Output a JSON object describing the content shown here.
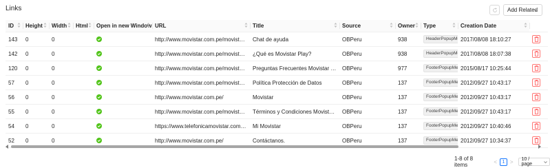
{
  "page": {
    "title": "Links"
  },
  "toolbar": {
    "add_related_label": "Add Related"
  },
  "table": {
    "columns": [
      "ID",
      "Height",
      "Width",
      "Html",
      "Open in new Window",
      "URL",
      "Title",
      "Source",
      "Owner",
      "Type",
      "Creation Date"
    ],
    "rows": [
      {
        "id": "143",
        "height": "0",
        "width": "0",
        "html": "",
        "new_window": true,
        "url": "http://www.movistar.com.pe/movistar-...",
        "title": "Chat de ayuda",
        "source": "OBPeru",
        "owner": "938",
        "type": "HeaderPopupMessage",
        "created": "2017/08/08 18:10:27"
      },
      {
        "id": "142",
        "height": "0",
        "width": "0",
        "html": "",
        "new_window": true,
        "url": "http://www.movistar.com.pe/movistar-...",
        "title": "¿Qué es Movistar Play?",
        "source": "OBPeru",
        "owner": "938",
        "type": "HeaderPopupMessage",
        "created": "2017/08/08 18:07:38"
      },
      {
        "id": "120",
        "height": "0",
        "width": "0",
        "html": "",
        "new_window": true,
        "url": "http://www.movistar.com.pe/movistar-...",
        "title": "Preguntas Frecuentes Movistar Play",
        "source": "OBPeru",
        "owner": "977",
        "type": "FooterPopupMessage",
        "created": "2015/08/17 10:25:44"
      },
      {
        "id": "57",
        "height": "0",
        "width": "0",
        "html": "",
        "new_window": true,
        "url": "http://www.movistar.com.pe/movistar-...",
        "title": "Política Protección de Datos",
        "source": "OBPeru",
        "owner": "137",
        "type": "FooterPopupMessage",
        "created": "2012/09/27 10:43:17"
      },
      {
        "id": "56",
        "height": "0",
        "width": "0",
        "html": "",
        "new_window": true,
        "url": "http://www.movistar.com.pe/",
        "title": "Movistar",
        "source": "OBPeru",
        "owner": "137",
        "type": "FooterPopupMessage",
        "created": "2012/09/27 10:43:17"
      },
      {
        "id": "55",
        "height": "0",
        "width": "0",
        "html": "",
        "new_window": true,
        "url": "http://www.movistar.com.pe/movistar-...",
        "title": "Términos y Condiciones Movistar Play",
        "source": "OBPeru",
        "owner": "137",
        "type": "FooterPopupMessage",
        "created": "2012/09/27 10:43:17"
      },
      {
        "id": "54",
        "height": "0",
        "width": "0",
        "html": "",
        "new_window": true,
        "url": "https://www.telefonicamovistar.com.pe...",
        "title": "Mi Movistar",
        "source": "OBPeru",
        "owner": "137",
        "type": "FooterPopupMessage",
        "created": "2012/09/27 10:40:46"
      },
      {
        "id": "52",
        "height": "0",
        "width": "0",
        "html": "",
        "new_window": true,
        "url": "http://www.movistar.com.pe/",
        "title": "Contáctanos.",
        "source": "OBPeru",
        "owner": "137",
        "type": "FooterPopupMessage",
        "created": "2012/09/27 10:34:37"
      }
    ]
  },
  "pagination": {
    "total_text": "1-8 of 8 items",
    "current_page": "1",
    "page_size": "10 / page"
  },
  "icons": {
    "check": "check-circle-icon",
    "delete": "trash-icon",
    "refresh": "refresh-icon",
    "sort": "sort-icon",
    "chevron": "chevron-down-icon"
  },
  "colors": {
    "accent": "#1677ff",
    "success": "#52c41a",
    "danger": "#ff4d4f"
  }
}
